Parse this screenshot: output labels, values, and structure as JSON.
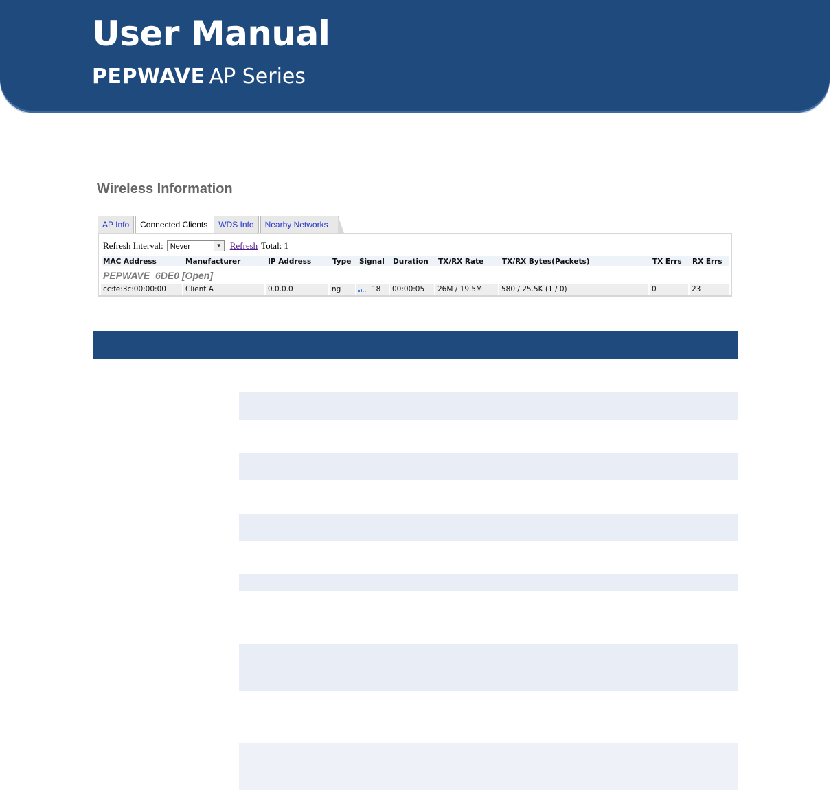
{
  "header": {
    "title": "User Manual",
    "brand": "PEPWAVE",
    "series": "AP Series"
  },
  "colors": {
    "banner": "#1f4a7e",
    "stripe": "#e9eef6",
    "link": "#2233cc"
  },
  "page": {
    "title": "Wireless Information"
  },
  "tabs": [
    {
      "label": "AP Info",
      "active": false
    },
    {
      "label": "Connected Clients",
      "active": true
    },
    {
      "label": "WDS Info",
      "active": false
    },
    {
      "label": "Nearby Networks",
      "active": false
    }
  ],
  "refresh": {
    "label": "Refresh Interval:",
    "interval": "Never",
    "link": "Refresh",
    "total": "Total: 1"
  },
  "table": {
    "headers": [
      "MAC Address",
      "Manufacturer",
      "IP Address",
      "Type",
      "Signal",
      "Duration",
      "TX/RX Rate",
      "TX/RX Bytes(Packets)",
      "TX Errs",
      "RX Errs"
    ],
    "ssid": "PEPWAVE_6DE0 [Open]",
    "rows": [
      {
        "mac": "cc:fe:3c:00:00:00",
        "manufacturer": "Client A",
        "ip": "0.0.0.0",
        "type": "ng",
        "signal": "18",
        "duration": "00:00:05",
        "rate": "26M / 19.5M",
        "bytes": "580 / 25.5K (1 / 0)",
        "tx_errs": "0",
        "rx_errs": "23"
      }
    ]
  }
}
